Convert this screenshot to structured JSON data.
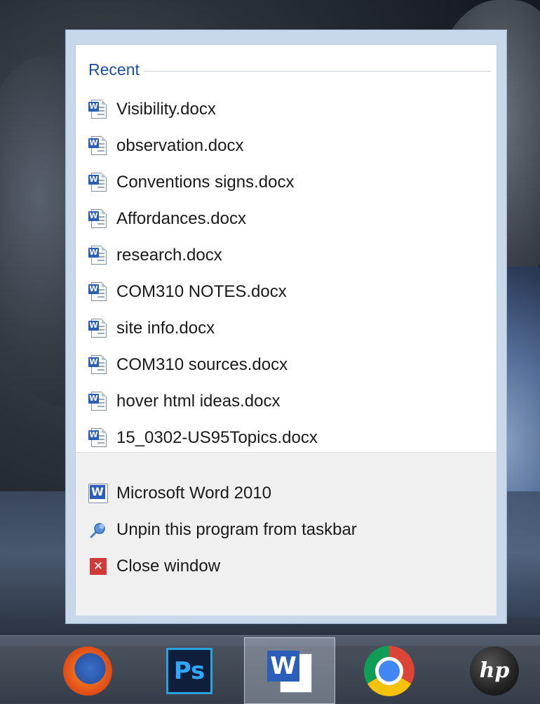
{
  "jumplist": {
    "recent_header": "Recent",
    "recent_items": [
      {
        "label": "Visibility.docx"
      },
      {
        "label": "observation.docx"
      },
      {
        "label": "Conventions signs.docx"
      },
      {
        "label": "Affordances.docx"
      },
      {
        "label": "research.docx"
      },
      {
        "label": "COM310 NOTES.docx"
      },
      {
        "label": "site info.docx"
      },
      {
        "label": "COM310 sources.docx"
      },
      {
        "label": "hover html ideas.docx"
      },
      {
        "label": "15_0302-US95Topics.docx"
      }
    ],
    "tasks": {
      "app_label": "Microsoft Word 2010",
      "unpin_label": "Unpin this program from taskbar",
      "close_label": "Close window"
    },
    "icon_names": {
      "document": "word-document-icon",
      "app": "microsoft-word-icon",
      "unpin": "unpin-icon",
      "close": "close-icon"
    },
    "accent_color": "#1e4f9a"
  },
  "taskbar": {
    "buttons": [
      {
        "icon": "firefox-icon",
        "active": false
      },
      {
        "icon": "photoshop-icon",
        "glyph": "Ps",
        "active": false
      },
      {
        "icon": "microsoft-word-icon",
        "glyph": "W",
        "active": true
      },
      {
        "icon": "chrome-icon",
        "active": false
      },
      {
        "icon": "hp-icon",
        "glyph": "hp",
        "active": false
      }
    ]
  }
}
